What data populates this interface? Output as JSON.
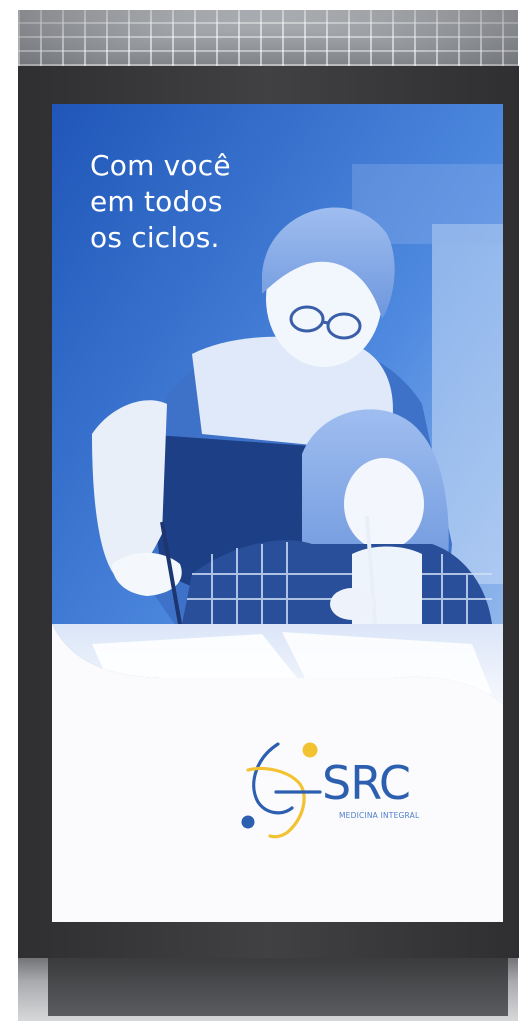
{
  "headline": {
    "line1": "Com você",
    "line2": "em todos",
    "line3": "os ciclos."
  },
  "brand": {
    "name": "SRC",
    "tagline": "MEDICINA INTEGRAL",
    "colors": {
      "primary_blue": "#2d5fb0",
      "accent_yellow": "#f2c230"
    }
  },
  "photo": {
    "subject": "woman-and-child-painting-photo",
    "tint_color": "#2b63c6"
  }
}
